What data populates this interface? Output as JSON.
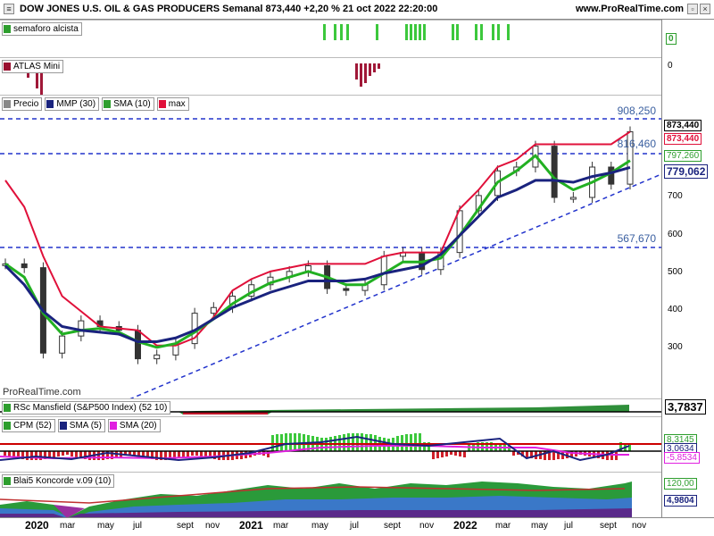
{
  "title": "DOW JONES U.S. OIL & GAS PRODUCERS Semanal 873,440 +2,20 % 21 oct 2022 22:20:00",
  "site": "www.ProRealTime.com",
  "watermark": "ProRealTime.com",
  "panes": {
    "semaforo": {
      "label": "semaforo alcista",
      "axis_top": "1",
      "axis_value": "0"
    },
    "atlas": {
      "label": "ATLAS Mini",
      "axis_value": "0"
    },
    "price": {
      "legend": [
        {
          "label": "Precio",
          "color": "#888888"
        },
        {
          "label": "MMP (30)",
          "color": "#1a237e"
        },
        {
          "label": "SMA (10)",
          "color": "#2e9e2e"
        },
        {
          "label": "max",
          "color": "#e0103a"
        }
      ],
      "levels": {
        "upper": "908,250",
        "mid": "816,460",
        "lower": "567,670"
      },
      "y_ticks": [
        "700",
        "600",
        "500",
        "400",
        "300"
      ],
      "values": {
        "price": "873,440",
        "max": "873,440",
        "sma": "797,260",
        "mmp": "779,062"
      }
    },
    "rsc": {
      "label": "RSc Mansfield (S&P500 Index) (52 10)",
      "value": "3,7837"
    },
    "cpm": {
      "legend": [
        {
          "label": "CPM (52)",
          "color": "#2e9e2e"
        },
        {
          "label": "SMA (5)",
          "color": "#1a237e"
        },
        {
          "label": "SMA (20)",
          "color": "#e020e0"
        }
      ],
      "values": {
        "a": "8,3145",
        "b": "3,0634",
        "c": "-5,8534"
      }
    },
    "koncorde": {
      "label": "Blai5 Koncorde v.09 (10)",
      "values": {
        "a": "120,00",
        "b": "4,9804"
      }
    }
  },
  "x_axis": [
    {
      "label": "2020",
      "bold": true
    },
    {
      "label": "mar"
    },
    {
      "label": "may"
    },
    {
      "label": "jul"
    },
    {
      "label": "sept"
    },
    {
      "label": "nov"
    },
    {
      "label": "2021",
      "bold": true
    },
    {
      "label": "mar"
    },
    {
      "label": "may"
    },
    {
      "label": "jul"
    },
    {
      "label": "sept"
    },
    {
      "label": "nov"
    },
    {
      "label": "2022",
      "bold": true
    },
    {
      "label": "mar"
    },
    {
      "label": "may"
    },
    {
      "label": "jul"
    },
    {
      "label": "sept"
    },
    {
      "label": "nov"
    }
  ],
  "chart_data": {
    "type": "line",
    "xlabel": "",
    "ylabel": "",
    "ylim": [
      200,
      950
    ],
    "x": [
      "2020-01",
      "2020-02",
      "2020-03",
      "2020-04",
      "2020-05",
      "2020-06",
      "2020-07",
      "2020-08",
      "2020-09",
      "2020-10",
      "2020-11",
      "2020-12",
      "2021-01",
      "2021-02",
      "2021-03",
      "2021-04",
      "2021-05",
      "2021-06",
      "2021-07",
      "2021-08",
      "2021-09",
      "2021-10",
      "2021-11",
      "2021-12",
      "2022-01",
      "2022-02",
      "2022-03",
      "2022-04",
      "2022-05",
      "2022-06",
      "2022-07",
      "2022-08",
      "2022-09",
      "2022-10"
    ],
    "series": [
      {
        "name": "Precio",
        "values": [
          525,
          515,
          290,
          335,
          375,
          360,
          350,
          275,
          285,
          315,
          395,
          410,
          440,
          470,
          490,
          505,
          520,
          460,
          455,
          470,
          545,
          555,
          510,
          555,
          665,
          705,
          770,
          780,
          835,
          700,
          700,
          780,
          735,
          873
        ]
      },
      {
        "name": "MMP (30)",
        "values": [
          520,
          470,
          400,
          360,
          350,
          345,
          340,
          320,
          320,
          330,
          350,
          380,
          410,
          430,
          450,
          465,
          480,
          480,
          480,
          485,
          500,
          510,
          520,
          550,
          600,
          650,
          700,
          720,
          745,
          745,
          740,
          755,
          765,
          779
        ]
      },
      {
        "name": "SMA (10)",
        "values": [
          525,
          490,
          395,
          340,
          350,
          355,
          345,
          320,
          305,
          315,
          345,
          380,
          420,
          450,
          475,
          490,
          505,
          490,
          470,
          470,
          500,
          530,
          530,
          540,
          600,
          670,
          740,
          770,
          810,
          750,
          720,
          740,
          765,
          797
        ]
      },
      {
        "name": "max",
        "values": [
          745,
          675,
          545,
          440,
          400,
          360,
          355,
          350,
          310,
          310,
          330,
          385,
          455,
          485,
          505,
          515,
          525,
          525,
          525,
          525,
          545,
          555,
          555,
          555,
          670,
          720,
          780,
          800,
          840,
          840,
          840,
          840,
          840,
          873
        ]
      }
    ]
  }
}
